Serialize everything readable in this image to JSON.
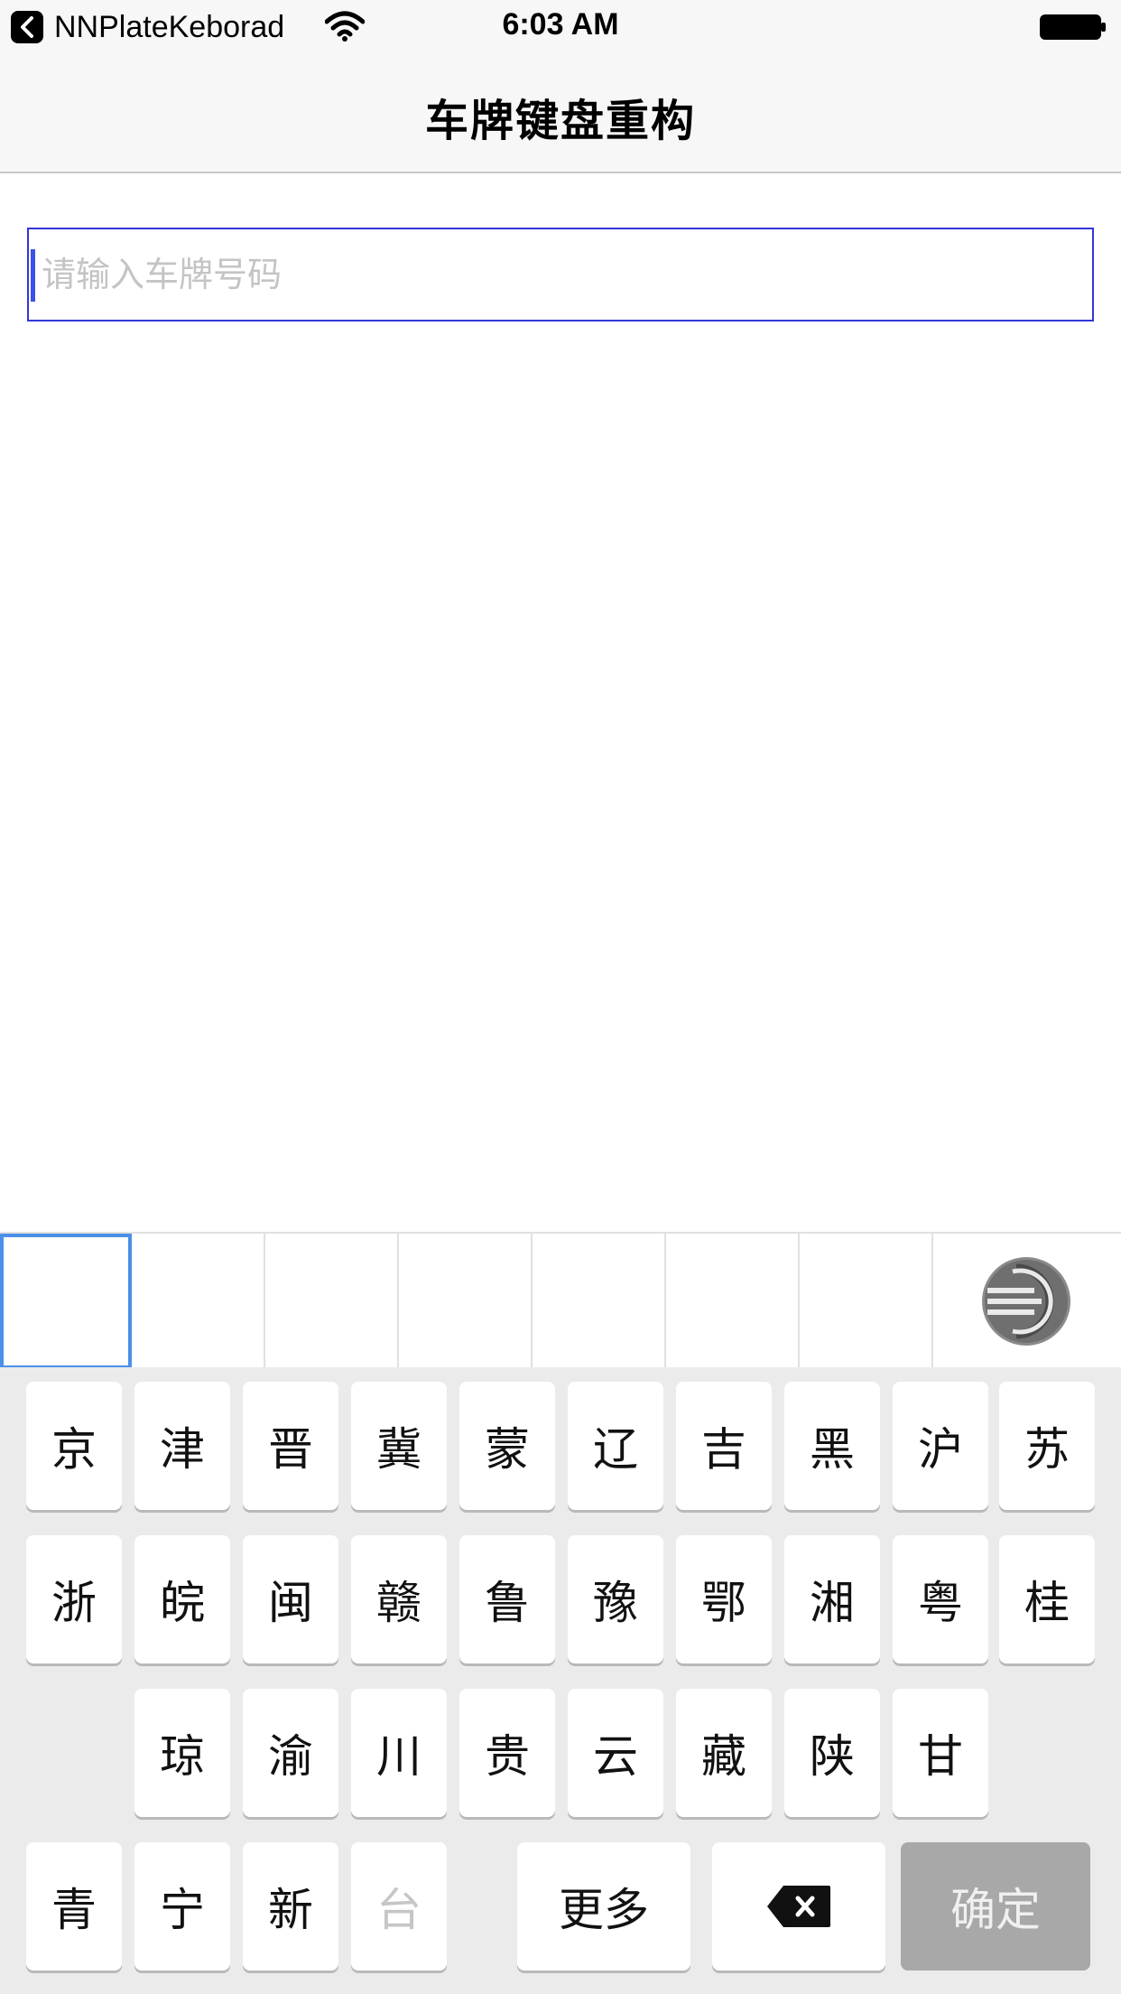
{
  "status_bar": {
    "back_app_label": "NNPlateKeborad",
    "time": "6:03 AM"
  },
  "nav": {
    "title": "车牌键盘重构"
  },
  "plate_input": {
    "value": "",
    "placeholder": "请输入车牌号码"
  },
  "plate_cells": [
    "",
    "",
    "",
    "",
    "",
    "",
    "",
    ""
  ],
  "keyboard": {
    "row1": [
      "京",
      "津",
      "晋",
      "冀",
      "蒙",
      "辽",
      "吉",
      "黑",
      "沪",
      "苏"
    ],
    "row2": [
      "浙",
      "皖",
      "闽",
      "赣",
      "鲁",
      "豫",
      "鄂",
      "湘",
      "粤",
      "桂"
    ],
    "row3": [
      "琼",
      "渝",
      "川",
      "贵",
      "云",
      "藏",
      "陕",
      "甘"
    ],
    "row4": [
      "青",
      "宁",
      "新",
      "台"
    ],
    "more_label": "更多",
    "delete_icon": "backspace-icon",
    "confirm_label": "确定"
  },
  "colors": {
    "accent": "#4a90e8",
    "input_border": "#3535d8",
    "confirm_bg": "#a8a8a8",
    "keyboard_bg": "#ebebeb"
  }
}
